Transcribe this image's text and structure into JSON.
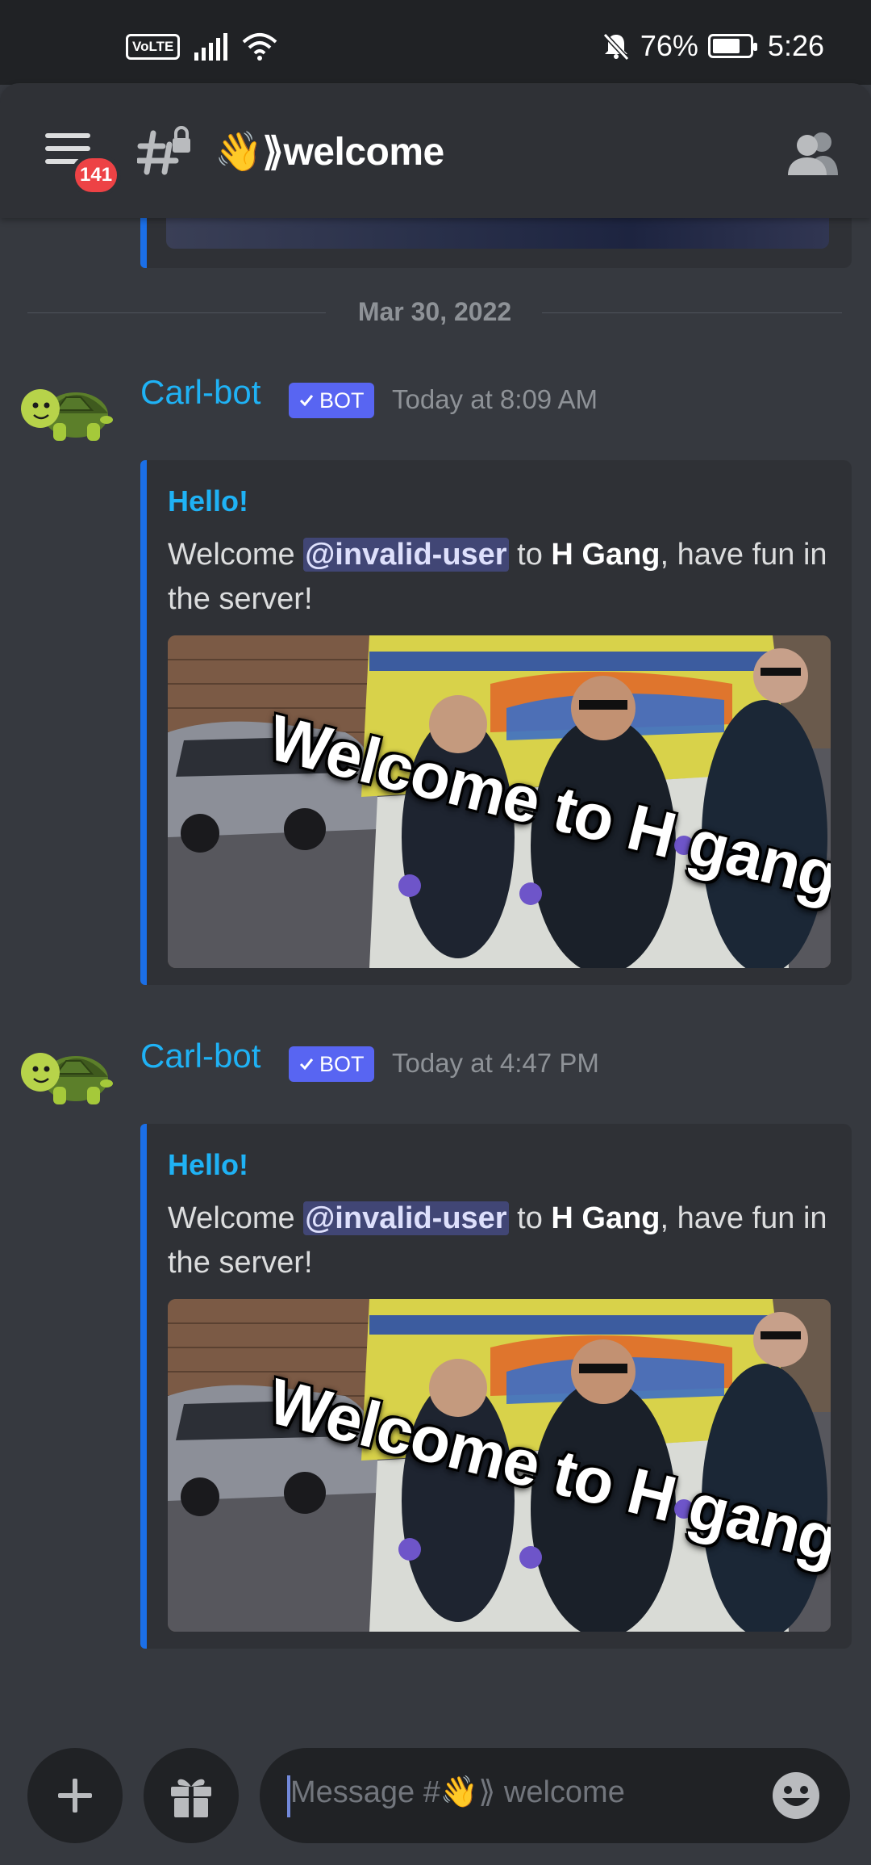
{
  "status_bar": {
    "volte": "VoLTE",
    "battery_percent": "76%",
    "time": "5:26",
    "battery_level": 0.76
  },
  "header": {
    "notification_count": "141",
    "channel_name": "👋⟫welcome"
  },
  "date_divider": "Mar 30, 2022",
  "messages": [
    {
      "author": "Carl-bot",
      "bot_tag": "BOT",
      "timestamp": "Today at 8:09 AM",
      "embed": {
        "title": "Hello!",
        "desc_prefix": "Welcome ",
        "mention": "@invalid-user",
        "desc_middle": " to ",
        "server": "H Gang",
        "desc_suffix": ", have fun in the server!",
        "gif_caption": "Welcome to H gang!"
      }
    },
    {
      "author": "Carl-bot",
      "bot_tag": "BOT",
      "timestamp": "Today at 4:47 PM",
      "embed": {
        "title": "Hello!",
        "desc_prefix": "Welcome ",
        "mention": "@invalid-user",
        "desc_middle": " to ",
        "server": "H Gang",
        "desc_suffix": ", have fun in the server!",
        "gif_caption": "Welcome to H gang!"
      }
    }
  ],
  "composer": {
    "placeholder": "Message #👋⟫ welcome"
  },
  "colors": {
    "background": "#36393f",
    "header": "#2f3136",
    "embed_accent": "#1b6fe7",
    "author": "#1fb2f5",
    "bot_tag": "#5865f2",
    "badge": "#ed4245",
    "mention_bg": "#414675"
  },
  "icons": {
    "hamburger": "menu-icon",
    "channel": "locked-text-channel-icon",
    "members": "members-icon",
    "plus": "plus-icon",
    "gift": "gift-icon",
    "emoji": "emoji-icon",
    "avatar": "turtle-avatar"
  }
}
